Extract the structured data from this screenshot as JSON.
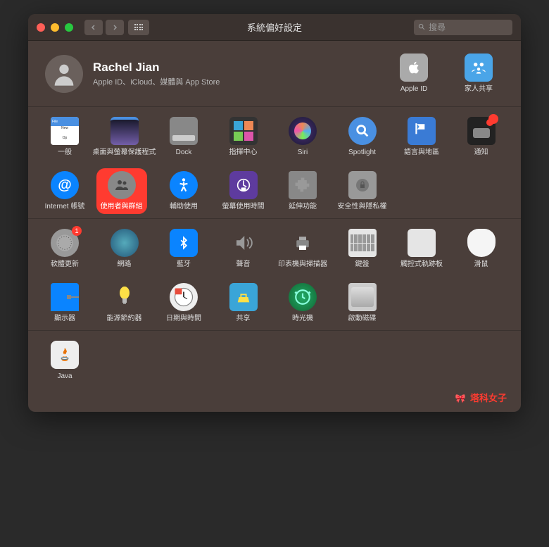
{
  "window": {
    "title": "系統偏好設定",
    "search_placeholder": "搜尋"
  },
  "user": {
    "name": "Rachel Jian",
    "subtitle": "Apple ID、iCloud、媒體與 App Store"
  },
  "header_items": [
    {
      "id": "apple-id",
      "label": "Apple ID",
      "icon": "apple"
    },
    {
      "id": "family",
      "label": "家人共享",
      "icon": "family"
    }
  ],
  "sections": [
    {
      "id": "personal",
      "items": [
        {
          "id": "general",
          "label": "一般",
          "icon": "general"
        },
        {
          "id": "desktop",
          "label": "桌面與螢幕保護程式",
          "icon": "desktop"
        },
        {
          "id": "dock",
          "label": "Dock",
          "icon": "dock"
        },
        {
          "id": "mission",
          "label": "指揮中心",
          "icon": "mission"
        },
        {
          "id": "siri",
          "label": "Siri",
          "icon": "siri"
        },
        {
          "id": "spotlight",
          "label": "Spotlight",
          "icon": "spotlight"
        },
        {
          "id": "language",
          "label": "語言與地區",
          "icon": "lang"
        },
        {
          "id": "notifications",
          "label": "通知",
          "icon": "notif",
          "badge": true
        }
      ]
    },
    {
      "id": "personal2",
      "items": [
        {
          "id": "internet",
          "label": "Internet 帳號",
          "icon": "internet"
        },
        {
          "id": "users",
          "label": "使用者與群組",
          "icon": "users",
          "highlighted": true
        },
        {
          "id": "accessibility",
          "label": "輔助使用",
          "icon": "access"
        },
        {
          "id": "screentime",
          "label": "螢幕使用時間",
          "icon": "screentime"
        },
        {
          "id": "extensions",
          "label": "延伸功能",
          "icon": "ext"
        },
        {
          "id": "security",
          "label": "安全性與隱私權",
          "icon": "security"
        }
      ]
    },
    {
      "id": "hardware",
      "items": [
        {
          "id": "update",
          "label": "軟體更新",
          "icon": "update",
          "badge": "1"
        },
        {
          "id": "network",
          "label": "網路",
          "icon": "network"
        },
        {
          "id": "bluetooth",
          "label": "藍牙",
          "icon": "bt"
        },
        {
          "id": "sound",
          "label": "聲音",
          "icon": "sound"
        },
        {
          "id": "printers",
          "label": "印表機與掃描器",
          "icon": "printer"
        },
        {
          "id": "keyboard",
          "label": "鍵盤",
          "icon": "keyboard"
        },
        {
          "id": "trackpad",
          "label": "觸控式軌跡板",
          "icon": "trackpad"
        },
        {
          "id": "mouse",
          "label": "滑鼠",
          "icon": "mouse"
        }
      ]
    },
    {
      "id": "hardware2",
      "items": [
        {
          "id": "displays",
          "label": "顯示器",
          "icon": "display"
        },
        {
          "id": "energy",
          "label": "能源節約器",
          "icon": "energy"
        },
        {
          "id": "datetime",
          "label": "日期與時間",
          "icon": "datetime"
        },
        {
          "id": "sharing",
          "label": "共享",
          "icon": "sharing"
        },
        {
          "id": "timemachine",
          "label": "時光機",
          "icon": "time"
        },
        {
          "id": "startup",
          "label": "啟動磁碟",
          "icon": "startup"
        }
      ]
    },
    {
      "id": "other",
      "items": [
        {
          "id": "java",
          "label": "Java",
          "icon": "java"
        }
      ]
    }
  ],
  "watermark": "塔科女子"
}
